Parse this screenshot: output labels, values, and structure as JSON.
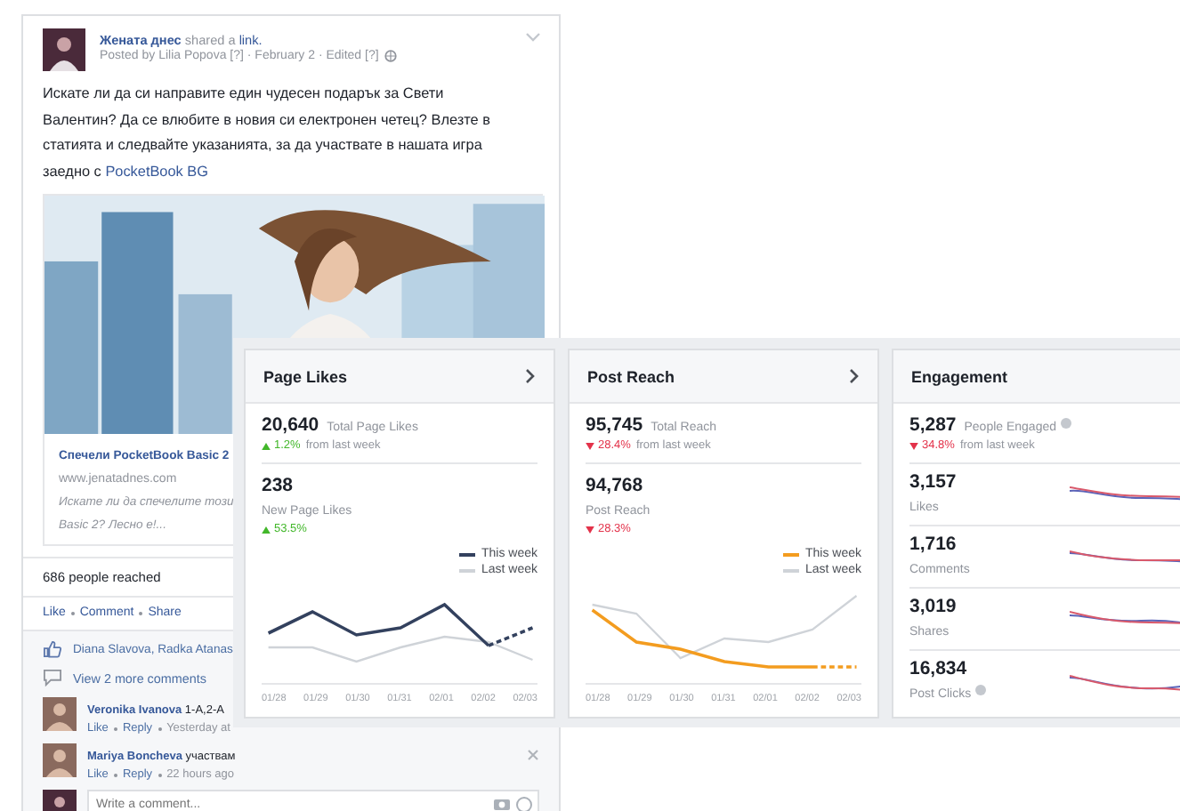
{
  "post": {
    "author": "Жената днес",
    "action": "shared a",
    "action_link": "link.",
    "meta": "Posted by Lilia Popova [?] · February 2 · Edited [?]",
    "body": "Искате ли да си направите един чудесен подарък за Свети Валентин? Да се влюбите в новия си електронен четец? Влезте в статията и следвайте указанията, за да участвате в нашата игра заедно с",
    "body_link": "PocketBook BG",
    "preview": {
      "kind": "picture",
      "title": "Спечели PocketBook Basic 2",
      "domain": "www.jenatadnes.com",
      "description": [
        "Искате ли да спечелите този",
        "Basic 2? Лесно е!..."
      ]
    },
    "reach": "686 people reached",
    "actions": [
      "Like",
      "Comment",
      "Share"
    ],
    "likes": "Diana Slavova, Radka Atanas",
    "more_comments": "View 2 more comments",
    "comments": [
      {
        "author": "Veronika Ivanova",
        "text": "1-A,2-A",
        "actions": [
          "Like",
          "Reply"
        ],
        "time": "Yesterday at",
        "closable": false
      },
      {
        "author": "Mariya Boncheva",
        "text": "участвам",
        "actions": [
          "Like",
          "Reply"
        ],
        "time": "22 hours ago",
        "closable": true
      }
    ],
    "composer": {
      "placeholder": "Write a comment..."
    }
  },
  "insights": [
    {
      "kind": "chart",
      "title": "Page Likes",
      "chevron": true,
      "stats": [
        {
          "value": "20,640",
          "label": "Total Page Likes",
          "change": "1.2%",
          "suffix": "from last week",
          "increase": true
        },
        {
          "value": "238",
          "label": "New Page Likes",
          "change": "53.5%",
          "increase": true
        }
      ],
      "legend": [
        {
          "label": "This week",
          "color": "#33415e"
        },
        {
          "label": "Last week",
          "color": "#cfd3d8"
        }
      ],
      "dates": [
        "01/28",
        "01/29",
        "01/30",
        "01/31",
        "02/01",
        "02/02",
        "02/03"
      ]
    },
    {
      "kind": "chart",
      "title": "Post Reach",
      "chevron": true,
      "stats": [
        {
          "value": "95,745",
          "label": "Total Reach",
          "change": "28.4%",
          "suffix": "from last week",
          "increase": false
        },
        {
          "value": "94,768",
          "label": "Post Reach",
          "change": "28.3%",
          "increase": false
        }
      ],
      "legend": [
        {
          "label": "This week",
          "color": "#f39c1f"
        },
        {
          "label": "Last week",
          "color": "#cfd3d8"
        }
      ],
      "dates": [
        "01/28",
        "01/29",
        "01/30",
        "01/31",
        "02/01",
        "02/02",
        "02/03"
      ]
    },
    {
      "kind": "metrics",
      "title": "Engagement",
      "chevron": false,
      "stats": [
        {
          "value": "5,287",
          "label": "People Engaged",
          "info": true,
          "change": "34.8%",
          "suffix": "from last week",
          "increase": false
        }
      ],
      "metrics": [
        {
          "value": "3,157",
          "label": "Likes",
          "info": false
        },
        {
          "value": "1,716",
          "label": "Comments",
          "info": false
        },
        {
          "value": "3,019",
          "label": "Shares",
          "info": false
        },
        {
          "value": "16,834",
          "label": "Post Clicks",
          "info": true
        }
      ]
    }
  ]
}
